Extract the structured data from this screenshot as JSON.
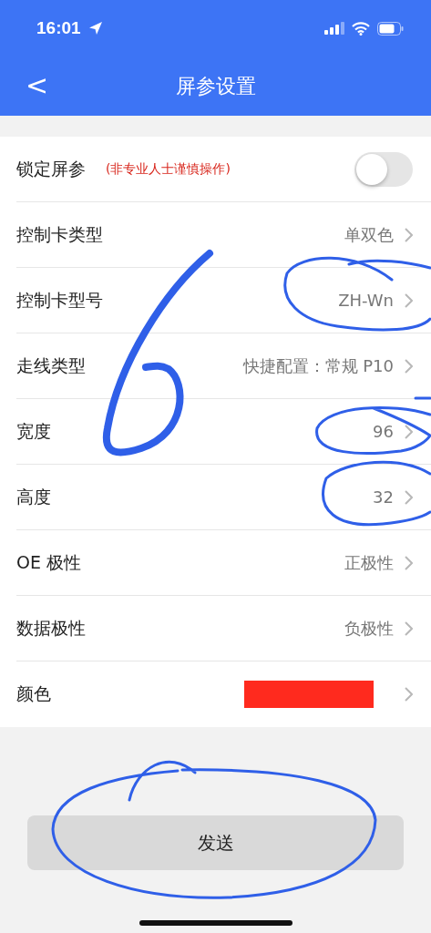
{
  "status_bar": {
    "time": "16:01"
  },
  "nav": {
    "back": "<",
    "title": "屏参设置"
  },
  "rows": [
    {
      "kind": "toggle",
      "label": "锁定屏参",
      "note": "(非专业人士谨慎操作)",
      "on": false
    },
    {
      "kind": "value",
      "label": "控制卡类型",
      "value": "单双色"
    },
    {
      "kind": "value",
      "label": "控制卡型号",
      "value": "ZH-Wn"
    },
    {
      "kind": "value",
      "label": "走线类型",
      "value": "快捷配置：常规 P10"
    },
    {
      "kind": "value",
      "label": "宽度",
      "value": "96"
    },
    {
      "kind": "value",
      "label": "高度",
      "value": "32"
    },
    {
      "kind": "value",
      "label": "OE 极性",
      "value": "正极性"
    },
    {
      "kind": "value",
      "label": "数据极性",
      "value": "负极性"
    },
    {
      "kind": "color",
      "label": "颜色",
      "color": "#ff2a1e"
    }
  ],
  "send_button": "发送"
}
